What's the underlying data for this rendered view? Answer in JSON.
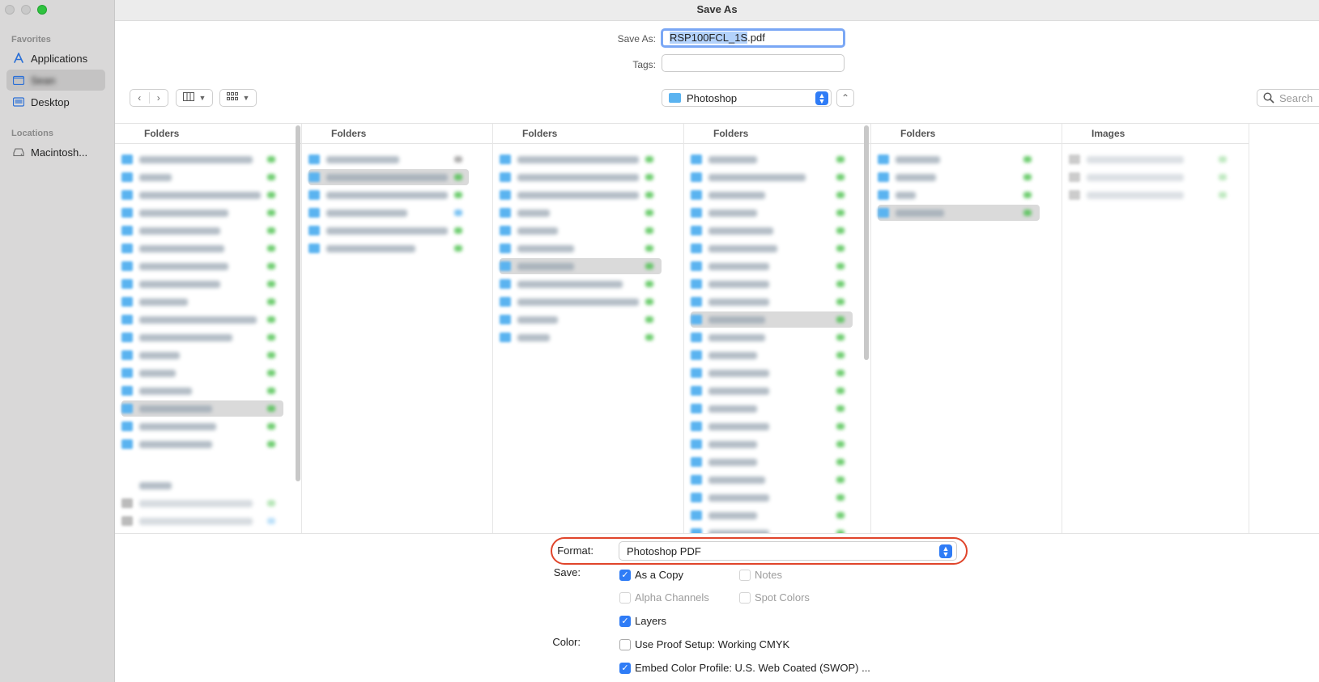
{
  "window": {
    "title": "Save As"
  },
  "sidebar": {
    "favorites_label": "Favorites",
    "locations_label": "Locations",
    "items": [
      {
        "label": "Applications"
      },
      {
        "label": "Sean"
      },
      {
        "label": "Desktop"
      },
      {
        "label": "Macintosh..."
      }
    ]
  },
  "save_as": {
    "label": "Save As:",
    "filename_selected": "RSP100FCL_1S",
    "filename_ext": ".pdf",
    "tags_label": "Tags:",
    "tags_value": ""
  },
  "toolbar": {
    "location": "Photoshop",
    "search_placeholder": "Search"
  },
  "browser": {
    "columns": [
      {
        "header": "Folders"
      },
      {
        "header": "Folders"
      },
      {
        "header": "Folders"
      },
      {
        "header": "Folders"
      },
      {
        "header": "Folders"
      },
      {
        "header": "Images"
      }
    ]
  },
  "options": {
    "format_label": "Format:",
    "format_value": "Photoshop PDF",
    "save_label": "Save:",
    "color_label": "Color:",
    "as_a_copy": "As a Copy",
    "notes": "Notes",
    "alpha_channels": "Alpha Channels",
    "spot_colors": "Spot Colors",
    "layers": "Layers",
    "use_proof_setup": "Use Proof Setup:  Working CMYK",
    "embed_color_profile": "Embed Color Profile:  U.S. Web Coated (SWOP) ..."
  }
}
